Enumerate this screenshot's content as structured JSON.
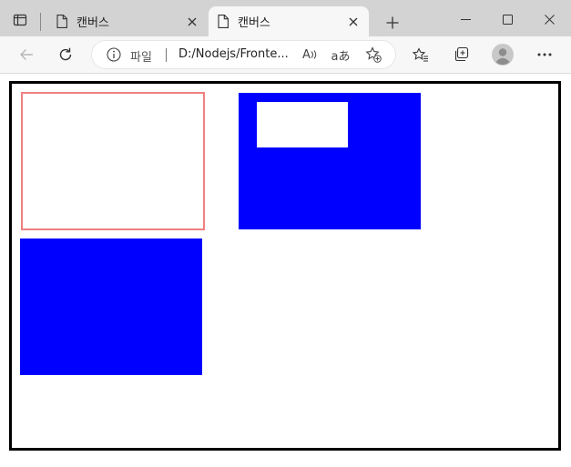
{
  "browser": {
    "tabs": [
      {
        "title": "캔버스",
        "active": false
      },
      {
        "title": "캔버스",
        "active": true
      }
    ],
    "address": {
      "scheme_label": "파일",
      "url": "D:/Nodejs/Fronte..."
    },
    "icons": {
      "tab_actions": "tab-actions-icon",
      "page": "page-icon",
      "close": "close-icon",
      "new_tab": "plus-icon",
      "minimize": "minimize-icon",
      "maximize": "maximize-icon",
      "window_close": "window-close-icon",
      "back": "back-arrow-icon",
      "refresh": "refresh-icon",
      "info": "info-icon",
      "read_aloud": "read-aloud-icon",
      "translate": "translate-icon",
      "favorite_add": "favorite-add-icon",
      "favorites": "favorites-icon",
      "collections": "collections-icon",
      "profile": "avatar-icon",
      "more": "more-icon"
    },
    "read_aloud_glyph": "A",
    "translate_glyph": "aあ"
  },
  "canvas": {
    "border_color": "#000000",
    "shapes": [
      {
        "name": "stroked-rect",
        "stroke": "#f08080",
        "fill": "none"
      },
      {
        "name": "filled-rect",
        "fill": "#0000ff"
      },
      {
        "name": "filled-rect-with-cleared-area",
        "fill": "#0000ff",
        "cleared_fill": "#ffffff"
      }
    ]
  }
}
